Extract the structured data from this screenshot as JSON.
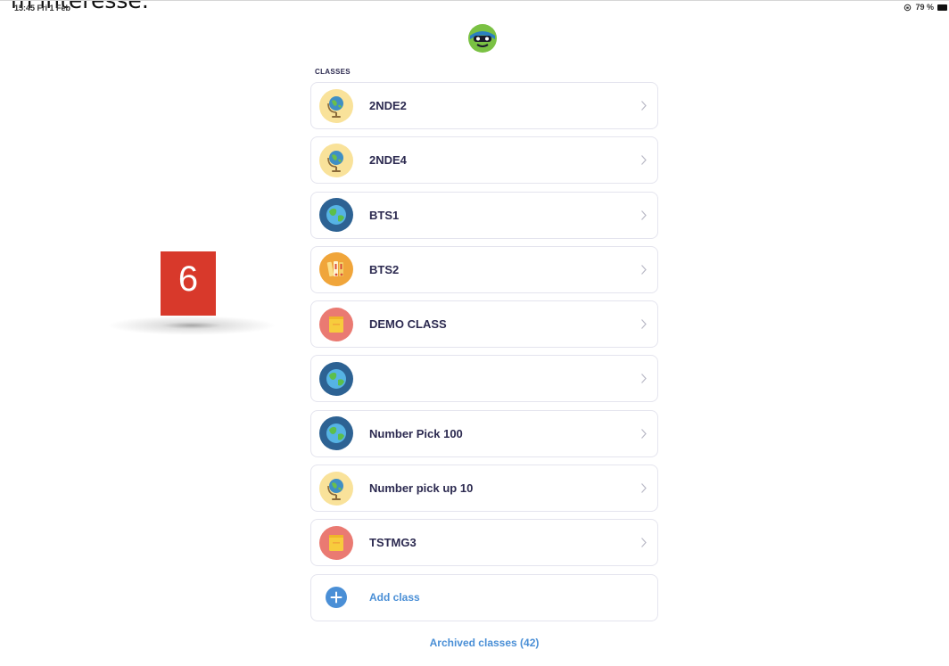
{
  "caption": "m interesse.",
  "status_bar": {
    "time": "15:45  Fri 1 Feb",
    "battery": "79 %"
  },
  "section_label": "CLASSES",
  "classes": [
    {
      "name": "2NDE2",
      "icon": "globe-stand-icon"
    },
    {
      "name": "2NDE4",
      "icon": "globe-stand-icon"
    },
    {
      "name": "BTS1",
      "icon": "earth-icon"
    },
    {
      "name": "BTS2",
      "icon": "books-icon"
    },
    {
      "name": "DEMO CLASS",
      "icon": "notebook-icon"
    },
    {
      "name": "",
      "icon": "earth-icon"
    },
    {
      "name": "Number Pick 100",
      "icon": "earth-icon"
    },
    {
      "name": "Number pick up 10",
      "icon": "globe-stand-icon"
    },
    {
      "name": "TSTMG3",
      "icon": "notebook-icon"
    }
  ],
  "add_class_label": "Add class",
  "archived_label": "Archived classes (42)",
  "step_badge": "6",
  "colors": {
    "accent_blue": "#4a8fd6",
    "text_dark": "#2c2a50",
    "badge_red": "#d8392b"
  }
}
